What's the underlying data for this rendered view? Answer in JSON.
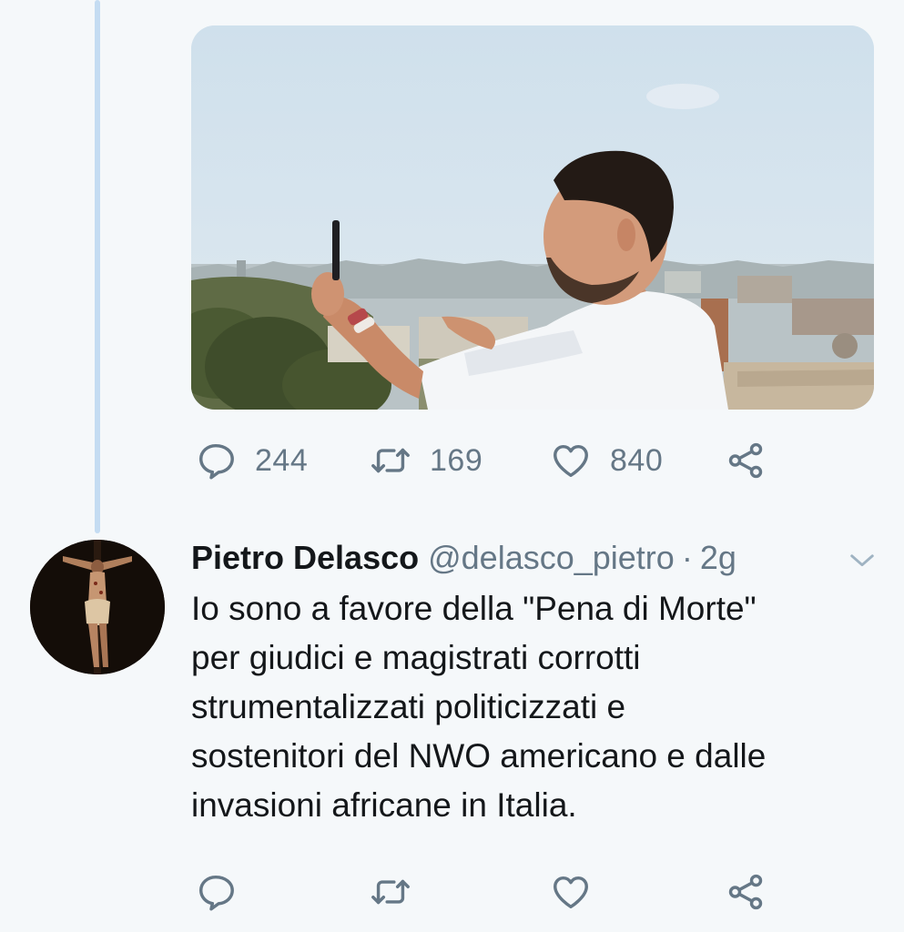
{
  "top_tweet": {
    "stats": {
      "replies": "244",
      "retweets": "169",
      "likes": "840"
    },
    "icons": {
      "reply": "reply-icon",
      "retweet": "retweet-icon",
      "like": "heart-icon",
      "share": "share-icon"
    }
  },
  "reply_tweet": {
    "display_name": "Pietro Delasco",
    "handle": "@delasco_pietro",
    "separator": "·",
    "time": "2g",
    "text": "Io sono a favore della \"Pena di Morte\"\nper giudici e magistrati corrotti\nstrumentalizzati politicizzati e\nsostenitori del NWO americano e dalle\ninvasioni africane in Italia.",
    "icons": {
      "menu": "chevron-down-icon",
      "reply": "reply-icon",
      "retweet": "retweet-icon",
      "like": "heart-icon",
      "share": "share-icon"
    }
  },
  "colors": {
    "background": "#f5f8fa",
    "icon_gray": "#657786",
    "text": "#14171a",
    "thread_line": "#c4dcf2"
  }
}
